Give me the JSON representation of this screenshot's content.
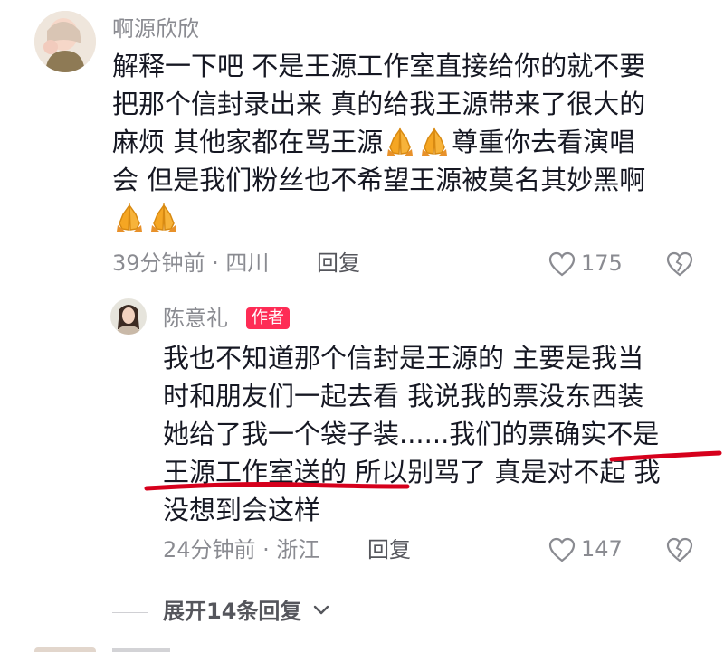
{
  "comment": {
    "username": "啊源欣欣",
    "lines": [
      "解释一下吧 不是王源工作室直接给你的就不要",
      "把那个信封录出来 真的给我王源带来了很大的",
      "麻烦 其他家都在骂王源",
      "尊重你去看演唱",
      "会 但是我们粉丝也不希望王源被莫名其妙黑啊"
    ],
    "time_location": "39分钟前 · 四川",
    "reply_label": "回复",
    "like_count": "175"
  },
  "reply": {
    "username": "陈意礼",
    "author_badge": "作者",
    "lines": [
      "我也不知道那个信封是王源的 主要是我当",
      "时和朋友们一起去看 我说我的票没东西装",
      "她给了我一个袋子装......我们的票确实不是",
      "王源工作室送的 所以别骂了 真是对不起 我",
      "没想到会这样"
    ],
    "time_location": "24分钟前 · 浙江",
    "reply_label": "回复",
    "like_count": "147"
  },
  "expand_replies_label": "展开14条回复",
  "icons": {
    "emoji": "praying-hands-emoji",
    "like": "heart-outline-icon",
    "dislike": "broken-heart-icon",
    "expand": "chevron-down-icon"
  },
  "colors": {
    "text": "#161823",
    "muted": "#8a8b91",
    "badge": "#fe2c55",
    "annotation": "#d6001c",
    "emoji": "#f5a623"
  }
}
